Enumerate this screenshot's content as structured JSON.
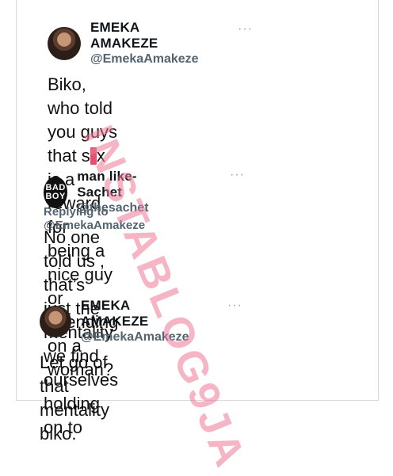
{
  "tweet1": {
    "display_name": "EMEKA AMAKEZE",
    "handle": "@EmekaAmakeze",
    "more": "···",
    "lines": [
      "Biko, who told you guys",
      "that s",
      "x is a reward for",
      "being a nice guy or",
      "spending on a woman?"
    ]
  },
  "tweet2": {
    "display_name": "man like-Sachet",
    "handle": "@thesachet",
    "more": "···",
    "avatar_text": [
      "BAD",
      "BOY"
    ],
    "replying_prefix": "Replying to",
    "replying_mention": "@EmekaAmakeze",
    "lines": [
      "No one told us , that’s",
      "just the mentality we find",
      "ourselves holding on to"
    ]
  },
  "tweet3": {
    "display_name": "EMEKA AMAKEZE",
    "handle": "@EmekaAmakeze",
    "more": "···",
    "lines": [
      "Let go of that mentality",
      "biko."
    ]
  },
  "watermark": "INSTABLOG9JA",
  "colors": {
    "text": "#0f1419",
    "secondary": "#536471",
    "watermark": "#ec7896"
  }
}
